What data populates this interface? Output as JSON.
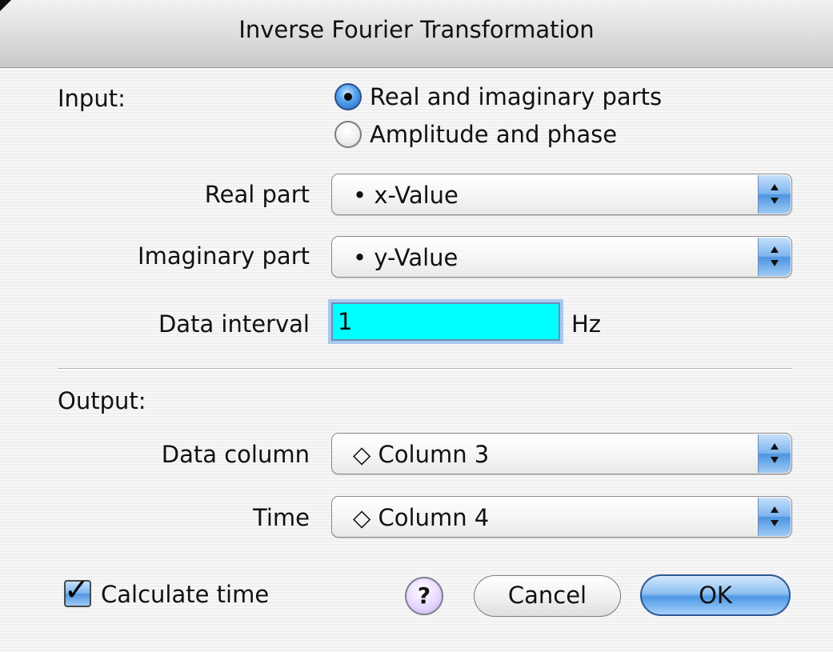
{
  "window": {
    "title": "Inverse Fourier Transformation"
  },
  "input": {
    "label": "Input:",
    "options": [
      {
        "label": "Real and imaginary parts",
        "selected": true
      },
      {
        "label": "Amplitude and phase",
        "selected": false
      }
    ],
    "real_part": {
      "label": "Real part",
      "value": "• x-Value"
    },
    "imaginary_part": {
      "label": "Imaginary part",
      "value": "• y-Value"
    },
    "data_interval": {
      "label": "Data interval",
      "value": "1",
      "unit": "Hz"
    }
  },
  "output": {
    "label": "Output:",
    "data_column": {
      "label": "Data column",
      "value": "◇ Column 3"
    },
    "time": {
      "label": "Time",
      "value": "◇ Column 4"
    }
  },
  "footer": {
    "calculate_time": {
      "label": "Calculate time",
      "checked": true
    },
    "help_label": "?",
    "cancel_label": "Cancel",
    "ok_label": "OK"
  },
  "colors": {
    "field_background": "#00ffff",
    "accent": "#4e98e6",
    "help_button": "#c6aef0"
  }
}
